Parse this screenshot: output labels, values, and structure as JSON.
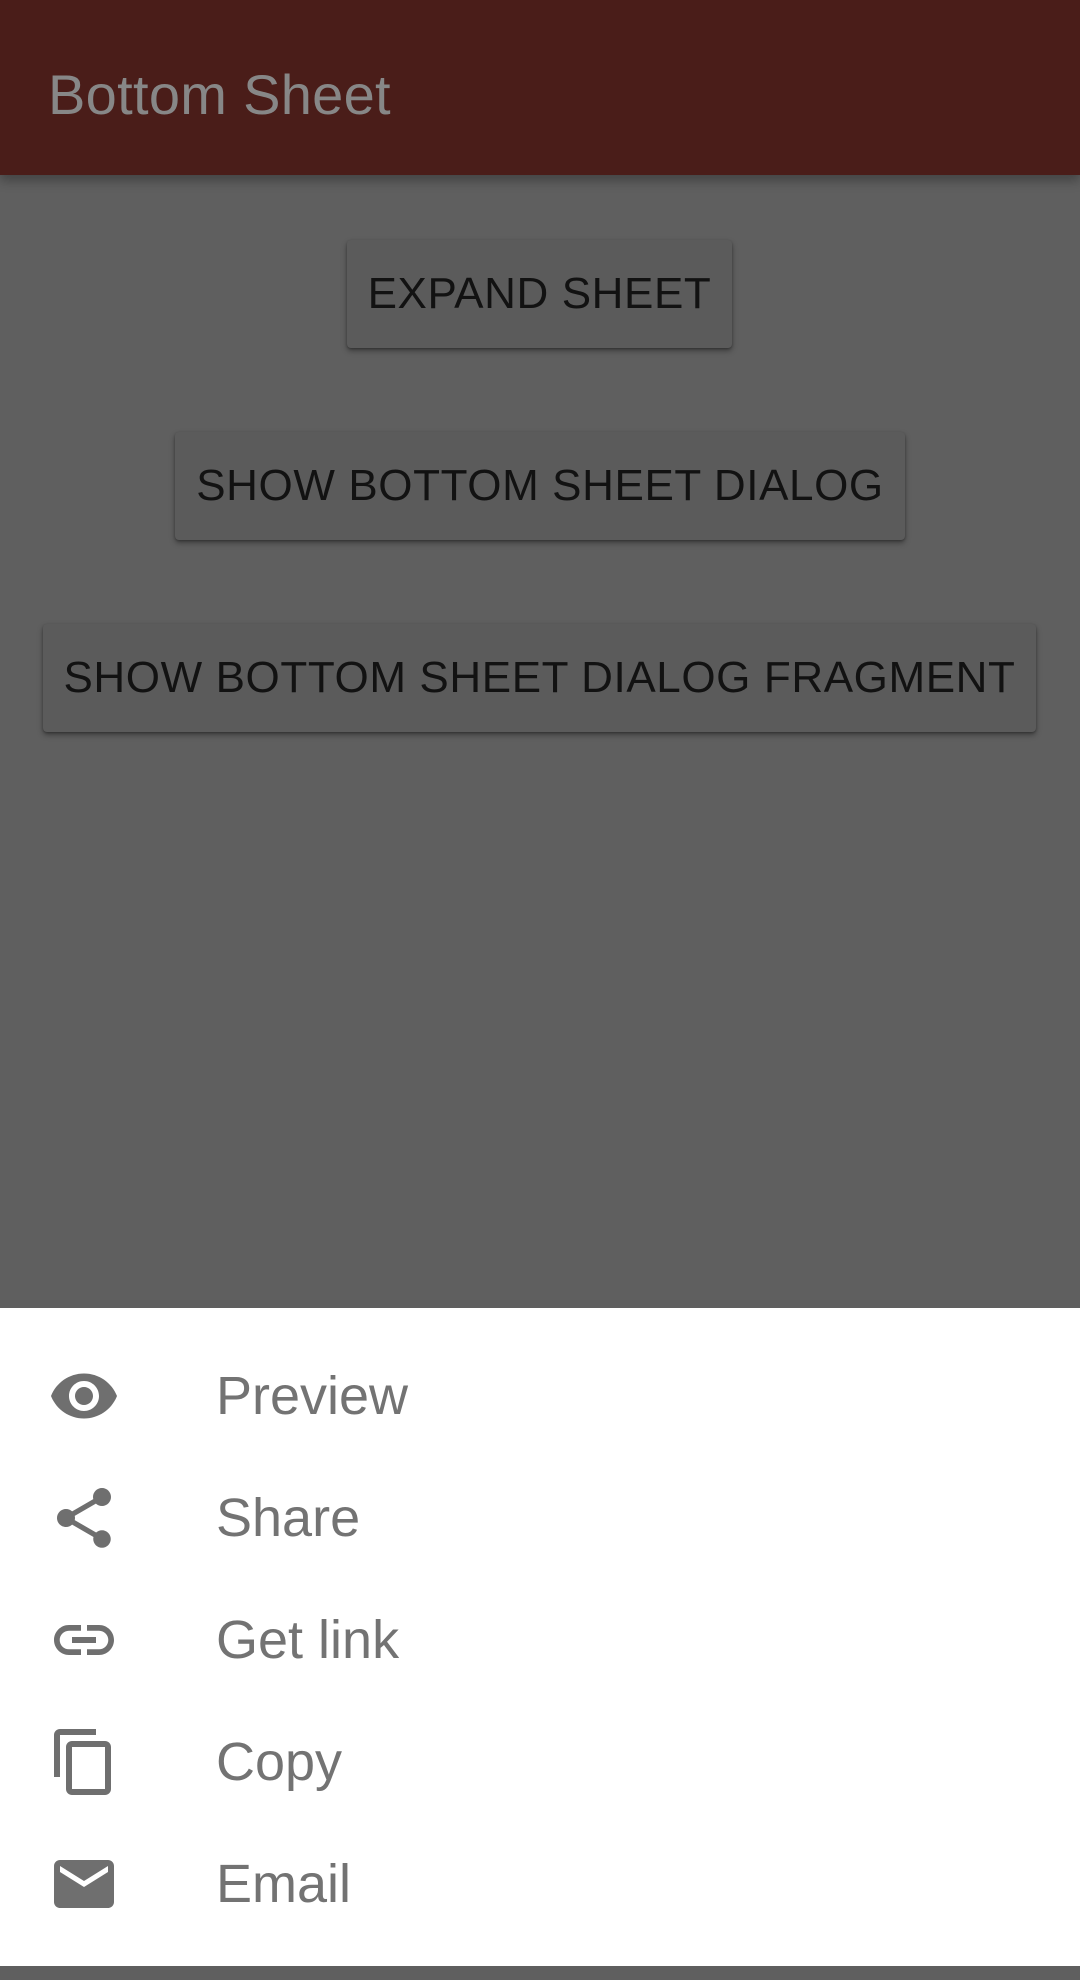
{
  "app_bar": {
    "title": "Bottom Sheet",
    "background_color": "#4a1d19"
  },
  "main": {
    "buttons": [
      {
        "label": "EXPAND SHEET"
      },
      {
        "label": "SHOW BOTTOM SHEET DIALOG"
      },
      {
        "label": "SHOW BOTTOM SHEET DIALOG FRAGMENT"
      }
    ],
    "scrim_color": "#5f5f5f"
  },
  "bottom_sheet": {
    "items": [
      {
        "label": "Preview",
        "icon": "eye-icon"
      },
      {
        "label": "Share",
        "icon": "share-icon"
      },
      {
        "label": "Get link",
        "icon": "link-icon"
      },
      {
        "label": "Copy",
        "icon": "copy-icon"
      },
      {
        "label": "Email",
        "icon": "email-icon"
      }
    ],
    "icon_color": "#6f6f6f",
    "text_color": "#737373"
  }
}
